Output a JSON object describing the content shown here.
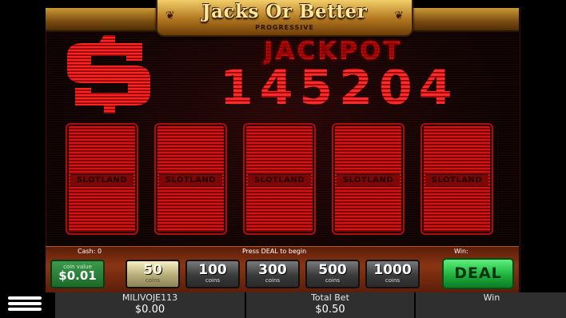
{
  "game": {
    "title": "Jacks Or Better",
    "subtitle": "PROGRESSIVE",
    "jackpot_label": "JACKPOT",
    "jackpot_value": "145204"
  },
  "cards": [
    {
      "label": "SLOTLAND"
    },
    {
      "label": "SLOTLAND"
    },
    {
      "label": "SLOTLAND"
    },
    {
      "label": "SLOTLAND"
    },
    {
      "label": "SLOTLAND"
    }
  ],
  "panel": {
    "cash_label": "Cash: 0",
    "message": "Press DEAL to begin",
    "win_label": "Win:",
    "coin_value_label": "coin value",
    "coin_value": "$0.01",
    "coin_buttons": [
      {
        "value": "50",
        "unit": "coins"
      },
      {
        "value": "100",
        "unit": "coins"
      },
      {
        "value": "300",
        "unit": "coins"
      },
      {
        "value": "500",
        "unit": "coins"
      },
      {
        "value": "1000",
        "unit": "coins"
      }
    ],
    "selected_coins": "50",
    "deal_label": "DEAL"
  },
  "status": {
    "player_name": "MILIVOJE113",
    "balance": "$0.00",
    "total_bet_label": "Total Bet",
    "total_bet": "$0.50",
    "win_label": "Win",
    "win_value": ""
  },
  "colors": {
    "accent_red": "#e01616",
    "gold": "#c99a33",
    "deal_green": "#1fb23d"
  }
}
